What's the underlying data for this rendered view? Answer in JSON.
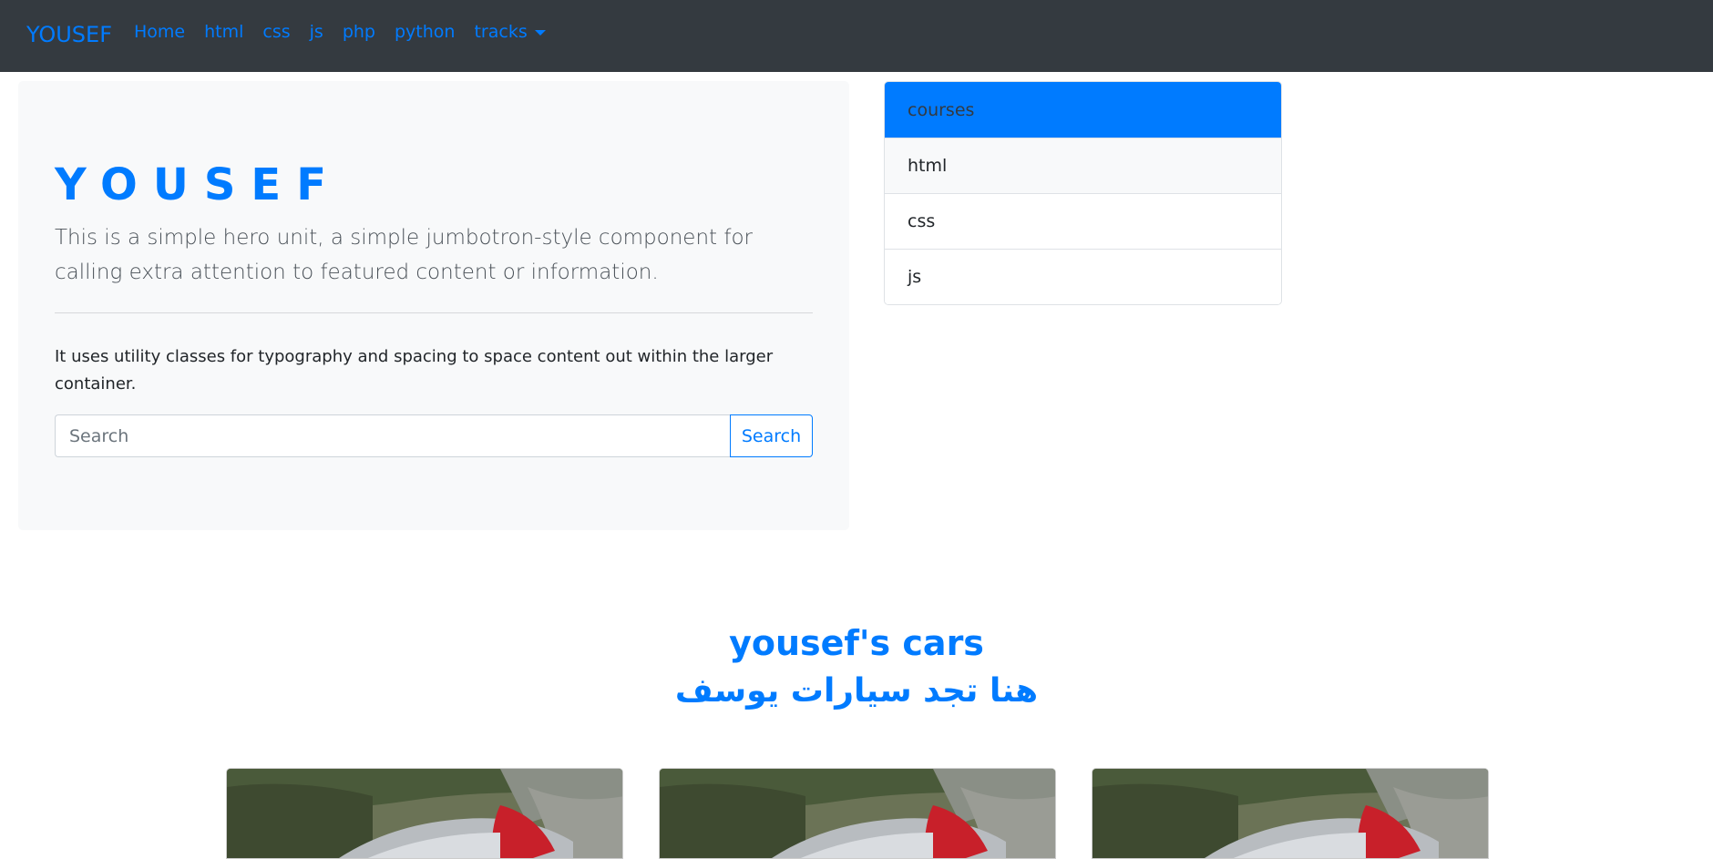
{
  "navbar": {
    "brand": "YOUSEF",
    "links": [
      "Home",
      "html",
      "css",
      "js",
      "php",
      "python"
    ],
    "dropdown_label": "tracks"
  },
  "jumbotron": {
    "title": "YOUSEF",
    "lead": "This is a simple hero unit, a simple jumbotron-style component for calling extra attention to featured content or information.",
    "body": "It uses utility classes for typography and spacing to space content out within the larger container.",
    "search_placeholder": "Search",
    "search_button": "Search"
  },
  "sidebar": {
    "items": [
      {
        "label": "courses",
        "state": "active"
      },
      {
        "label": "html",
        "state": "light"
      },
      {
        "label": "css",
        "state": "default"
      },
      {
        "label": "js",
        "state": "default"
      }
    ]
  },
  "cars": {
    "title": "yousef's cars",
    "subtitle": "هنا تجد سيارات يوسف",
    "cards": [
      {
        "image": "red-sports-car-photo"
      },
      {
        "image": "red-sports-car-photo"
      },
      {
        "image": "red-sports-car-photo"
      }
    ]
  },
  "colors": {
    "accent": "#007bff",
    "navbar_bg": "#343a40",
    "jumbotron_bg": "#f8f9fa"
  }
}
